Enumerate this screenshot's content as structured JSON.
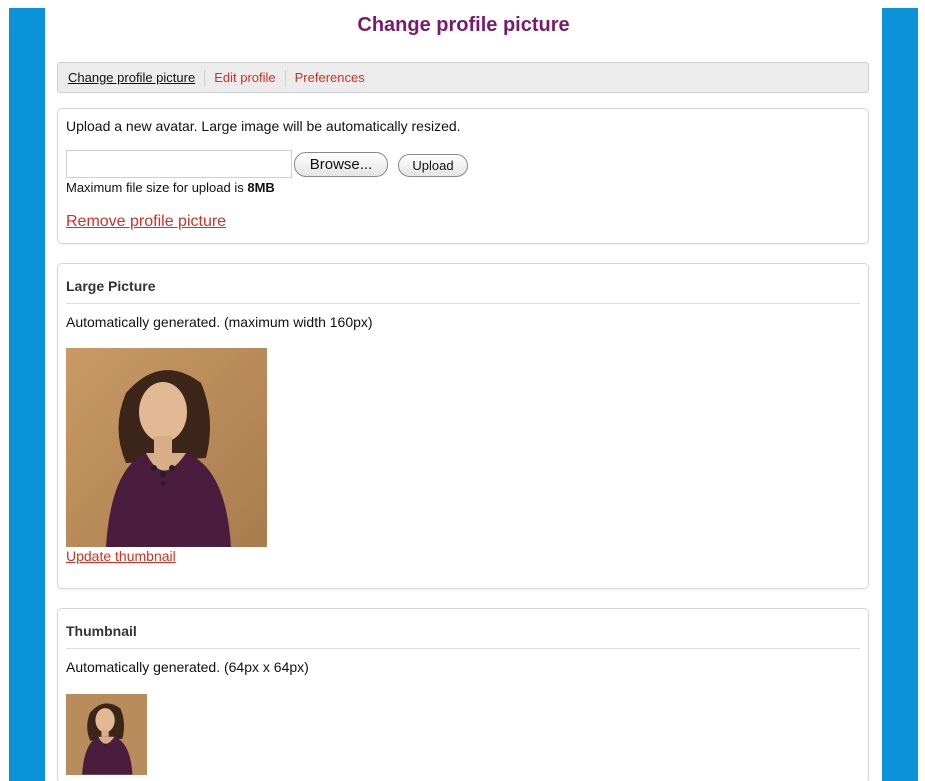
{
  "page": {
    "title": "Change profile picture"
  },
  "tabs": [
    {
      "label": "Change profile picture",
      "active": true
    },
    {
      "label": "Edit profile",
      "active": false
    },
    {
      "label": "Preferences",
      "active": false
    }
  ],
  "upload": {
    "intro": "Upload a new avatar. Large image will be automatically resized.",
    "file_value": "",
    "browse_label": "Browse...",
    "upload_label": "Upload",
    "max_size_prefix": "Maximum file size for upload is ",
    "max_size_value": "8MB",
    "remove_label": "Remove profile picture"
  },
  "large_picture": {
    "heading": "Large Picture",
    "description": "Automatically generated. (maximum width 160px)",
    "update_label": "Update thumbnail"
  },
  "thumbnail": {
    "heading": "Thumbnail",
    "description": "Automatically generated. (64px x 64px)"
  },
  "colors": {
    "side_bar": "#0b93d9",
    "title": "#7a1a6e",
    "link": "#d92d20"
  }
}
